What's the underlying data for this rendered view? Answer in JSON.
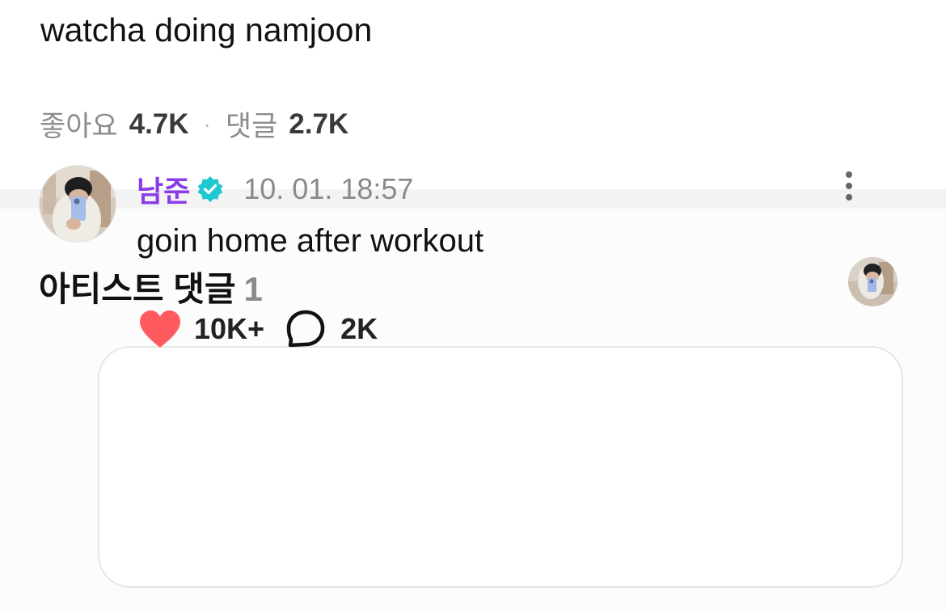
{
  "post": {
    "text": "watcha doing namjoon",
    "likes_label": "좋아요",
    "likes_value": "4.7K",
    "separator": "·",
    "comments_label": "댓글",
    "comments_value": "2.7K"
  },
  "artist_comments": {
    "title": "아티스트 댓글",
    "count": "1",
    "comment": {
      "author": "남준",
      "verified": true,
      "timestamp": "10. 01. 18:57",
      "text": "goin home after workout",
      "likes": "10K+",
      "replies": "2K"
    }
  },
  "colors": {
    "author_name": "#8a3ce6",
    "verified_badge": "#1ec8d2",
    "heart": "#ff5a5f",
    "divider": "#f3f3f3"
  },
  "icons": {
    "verified": "verified-badge-icon",
    "like": "heart-icon",
    "reply": "speech-bubble-icon",
    "more": "vertical-dots-icon"
  }
}
